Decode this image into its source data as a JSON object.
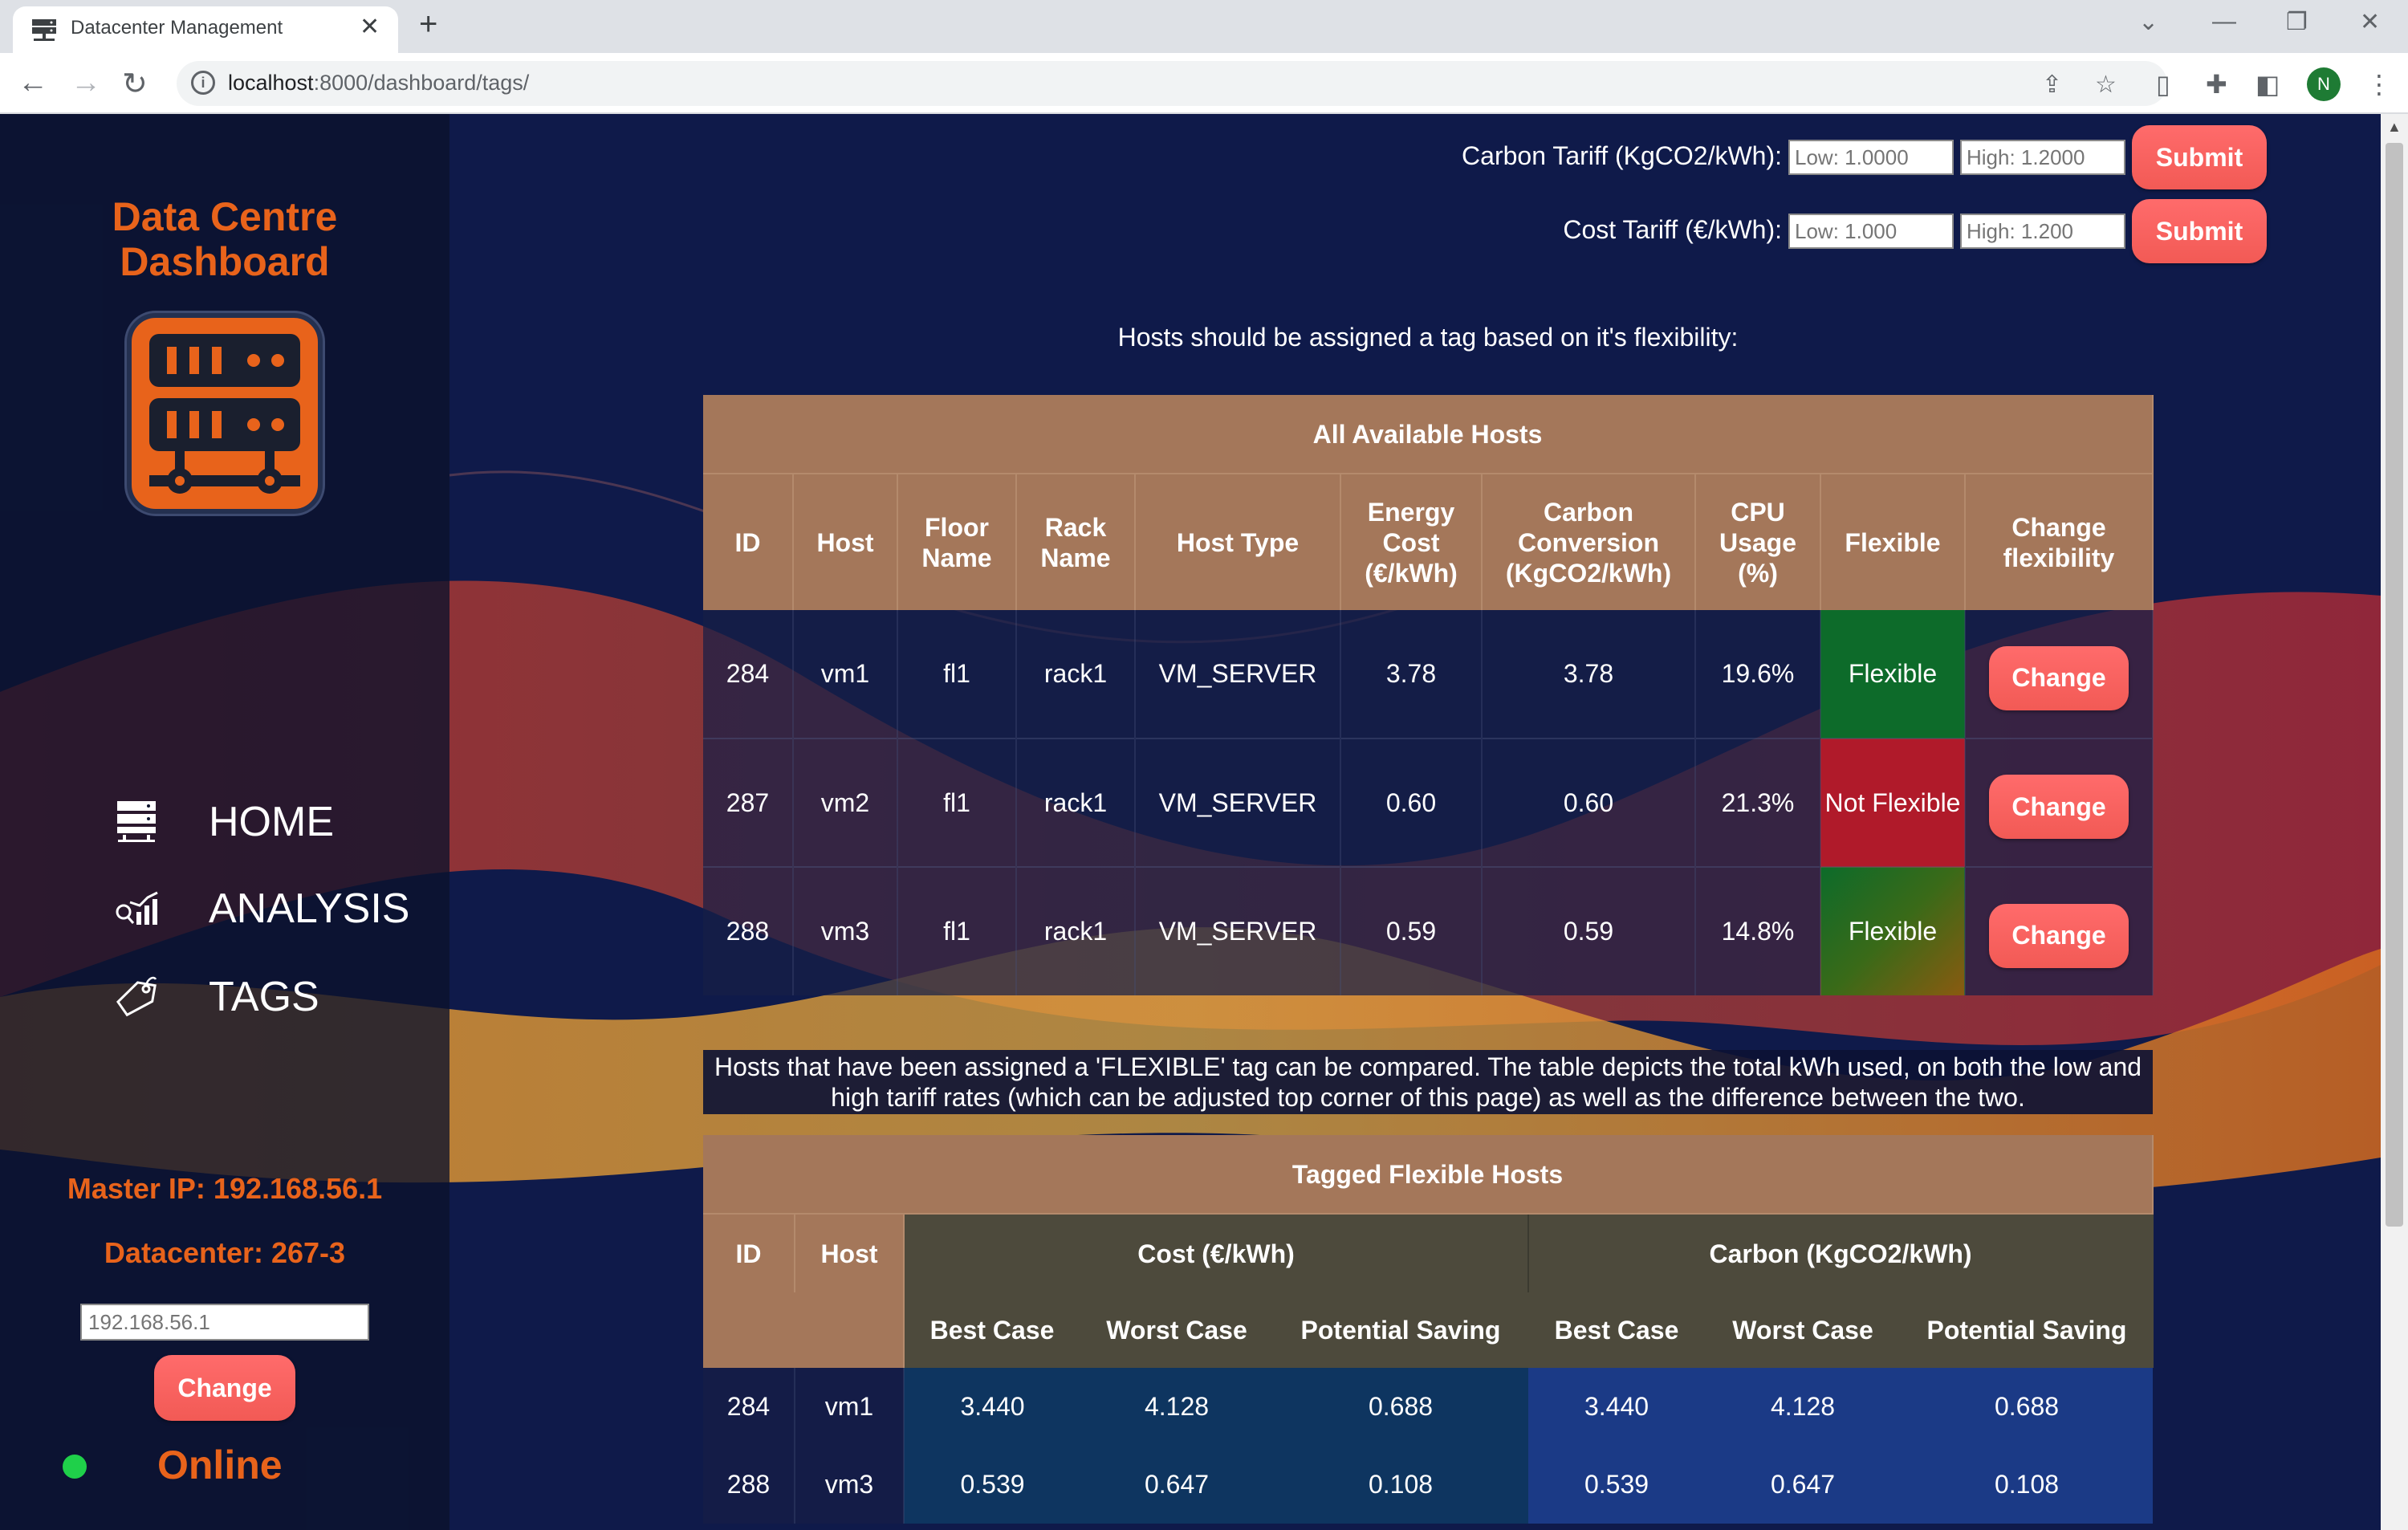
{
  "browser": {
    "tab_title": "Datacenter Management",
    "url_host": "localhost",
    "url_path": ":8000/dashboard/tags/",
    "profile_initial": "N"
  },
  "sidebar": {
    "brand_line1": "Data Centre",
    "brand_line2": "Dashboard",
    "nav": [
      {
        "label": "HOME",
        "icon": "server-icon"
      },
      {
        "label": "ANALYSIS",
        "icon": "analysis-chart-icon"
      },
      {
        "label": "TAGS",
        "icon": "tag-icon"
      }
    ],
    "master_ip": "Master IP: 192.168.56.1",
    "datacenter": "Datacenter: 267-3",
    "ip_input_placeholder": "192.168.56.1",
    "change_label": "Change",
    "status": "Online",
    "status_color": "#1fd04a"
  },
  "tariffs": {
    "carbon": {
      "label": "Carbon Tariff (KgCO2/kWh):",
      "low_placeholder": "Low: 1.0000",
      "high_placeholder": "High: 1.2000",
      "submit": "Submit"
    },
    "cost": {
      "label": "Cost Tariff (€/kWh):",
      "low_placeholder": "Low: 1.000",
      "high_placeholder": "High: 1.200",
      "submit": "Submit"
    }
  },
  "hosts_section": {
    "intro": "Hosts should be assigned a tag based on it's flexibility:",
    "title": "All Available Hosts",
    "columns": [
      "ID",
      "Host",
      "Floor Name",
      "Rack Name",
      "Host Type",
      "Energy Cost (€/kWh)",
      "Carbon Conversion (KgCO2/kWh)",
      "CPU Usage (%)",
      "Flexible",
      "Change flexibility"
    ],
    "rows": [
      {
        "id": "284",
        "host": "vm1",
        "floor": "fl1",
        "rack": "rack1",
        "type": "VM_SERVER",
        "energy": "3.78",
        "carbon": "3.78",
        "cpu": "19.6%",
        "flexible": "Flexible",
        "action": "Change"
      },
      {
        "id": "287",
        "host": "vm2",
        "floor": "fl1",
        "rack": "rack1",
        "type": "VM_SERVER",
        "energy": "0.60",
        "carbon": "0.60",
        "cpu": "21.3%",
        "flexible": "Not Flexible",
        "action": "Change"
      },
      {
        "id": "288",
        "host": "vm3",
        "floor": "fl1",
        "rack": "rack1",
        "type": "VM_SERVER",
        "energy": "0.59",
        "carbon": "0.59",
        "cpu": "14.8%",
        "flexible": "Flexible",
        "action": "Change"
      }
    ]
  },
  "flexible_section": {
    "intro": "Hosts that have been assigned a 'FLEXIBLE' tag can be compared. The table depicts the total kWh used, on both the low and high tariff rates (which can be adjusted top corner of this page) as well as the difference between the two.",
    "title": "Tagged Flexible Hosts",
    "col_id": "ID",
    "col_host": "Host",
    "group_cost": "Cost (€/kWh)",
    "group_carbon": "Carbon (KgCO2/kWh)",
    "sub": [
      "Best Case",
      "Worst Case",
      "Potential Saving"
    ],
    "rows": [
      {
        "id": "284",
        "host": "vm1",
        "cost": [
          "3.440",
          "4.128",
          "0.688"
        ],
        "carbon": [
          "3.440",
          "4.128",
          "0.688"
        ]
      },
      {
        "id": "288",
        "host": "vm3",
        "cost": [
          "0.539",
          "0.647",
          "0.108"
        ],
        "carbon": [
          "0.539",
          "0.647",
          "0.108"
        ]
      }
    ]
  },
  "colors": {
    "accent": "#e8631b",
    "button": "#f25a55",
    "header": "#a4775a",
    "flexible": "#0d6b2a",
    "not_flexible": "#b01a2a"
  }
}
